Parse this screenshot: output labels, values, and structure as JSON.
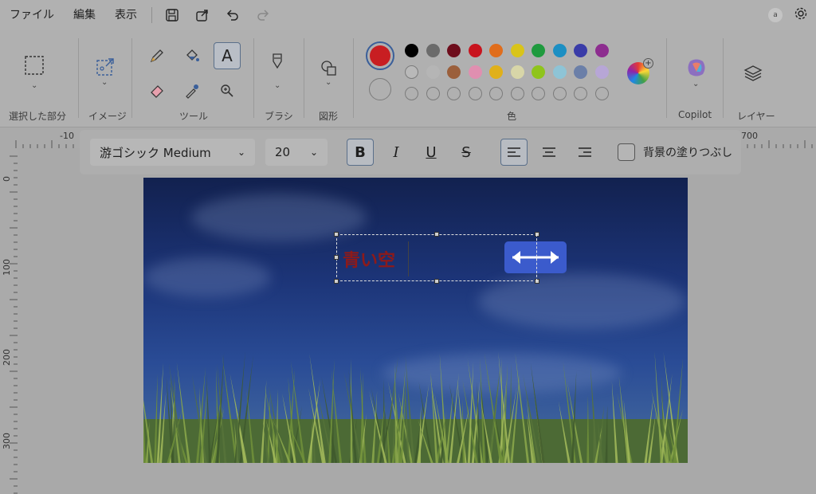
{
  "menu": {
    "file": "ファイル",
    "edit": "編集",
    "view": "表示"
  },
  "ribbon": {
    "groups": {
      "selection": "選択した部分",
      "image": "イメージ",
      "tools": "ツール",
      "brush": "ブラシ",
      "shapes": "図形",
      "colors": "色",
      "copilot": "Copilot",
      "layers": "レイヤー"
    },
    "current_color": "#c81e22",
    "palette_row1": [
      "#000000",
      "#6b6b6b",
      "#6e0d1c",
      "#c8141e",
      "#e06d1c",
      "#d9c41a",
      "#1f9a3e",
      "#1c8fc3",
      "#3a3ca8",
      "#8d2d8f"
    ],
    "palette_row2": [
      "#ffffff",
      "#b5b5b5",
      "#9b5f3b",
      "#e08fb0",
      "#e0b01a",
      "#d8d6a8",
      "#8fc41c",
      "#8ec4d6",
      "#6b7fa8",
      "#b7a6d6"
    ]
  },
  "texttoolbar": {
    "font": "游ゴシック Medium",
    "size": "20",
    "bold": "B",
    "italic": "I",
    "underline": "U",
    "strike": "S",
    "fill_bg_label": "背景の塗りつぶし"
  },
  "ruler": {
    "h_left": "-10",
    "h_right": "700",
    "v_marks": [
      "0",
      "100",
      "200",
      "300"
    ]
  },
  "canvas": {
    "typed_text": "青い空"
  }
}
